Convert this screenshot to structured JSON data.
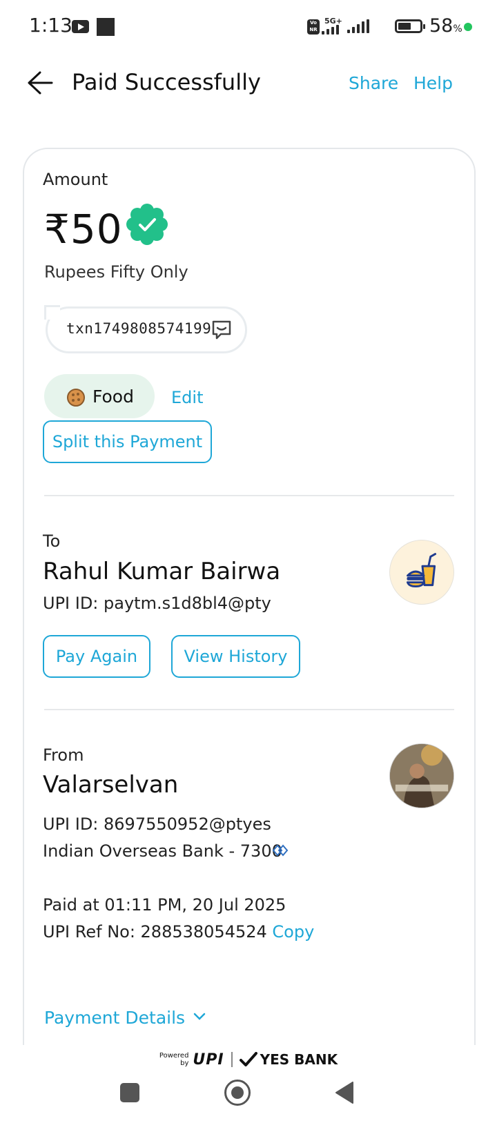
{
  "status_bar": {
    "time": "1:13",
    "network": "5G+",
    "battery_percent": "58",
    "battery_unit": "%",
    "vonr_label": "VoNR"
  },
  "header": {
    "title": "Paid Successfully",
    "share_label": "Share",
    "help_label": "Help"
  },
  "amount": {
    "label": "Amount",
    "value": "₹50",
    "words": "Rupees Fifty Only",
    "txn_note": "txn1749808574199"
  },
  "category": {
    "label": "Food",
    "edit_label": "Edit"
  },
  "split_button_label": "Split this Payment",
  "to": {
    "label": "To",
    "name": "Rahul Kumar Bairwa",
    "upi": "UPI ID: paytm.s1d8bl4@pty",
    "pay_again_label": "Pay Again",
    "view_history_label": "View History"
  },
  "from": {
    "label": "From",
    "name": "Valarselvan",
    "upi": "UPI ID: 8697550952@ptyes",
    "bank": "Indian Overseas Bank - 7300",
    "paid_at": "Paid at 01:11 PM, 20 Jul 2025",
    "ref_label": "UPI Ref No: 288538054524",
    "copy_label": "Copy"
  },
  "payment_details_label": "Payment Details",
  "footer": {
    "powered": "Powered",
    "by": "by",
    "upi_logo": "UPI",
    "bank": "YES BANK"
  },
  "colors": {
    "accent": "#1ea7d7",
    "success": "#22c08a",
    "chip": "#e6f4ec"
  }
}
